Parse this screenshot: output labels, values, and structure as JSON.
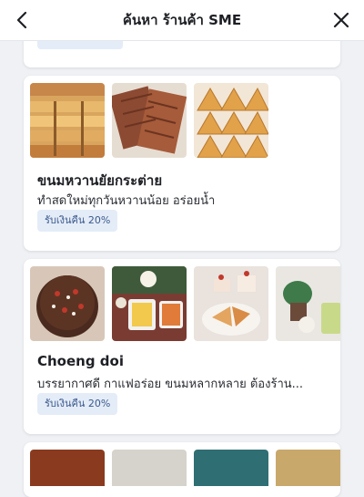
{
  "header": {
    "title": "ค้นหา ร้านค้า SME"
  },
  "stores": [
    {
      "name": "ขนมหวานยัยกระต่าย",
      "description": "ทำสดใหม่ทุกวันหวานน้อย อร่อยน้ำ",
      "badge": "รับเงินคืน 20%"
    },
    {
      "name": "Choeng doi",
      "description": "บรรยากาศดี กาแฟอร่อย ขนมหลากหลาย ต้องร้าน...",
      "badge": "รับเงินคืน 20%"
    }
  ],
  "colors": {
    "background": "#eff1f5",
    "card": "#ffffff",
    "badge_bg": "#e4ecf8",
    "badge_text": "#3c5a8c"
  }
}
